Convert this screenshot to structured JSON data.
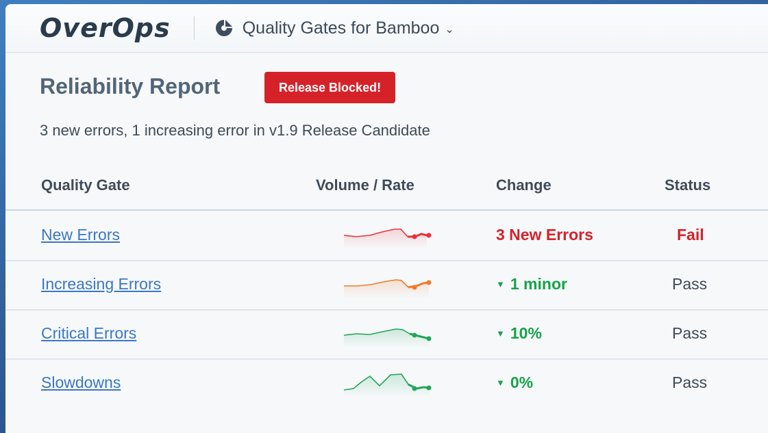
{
  "header": {
    "logo_text": "OverOps",
    "app_title": "Quality Gates for Bamboo",
    "chevron": "⌄"
  },
  "report": {
    "title": "Reliability Report",
    "badge": "Release Blocked!",
    "summary": "3 new errors, 1 increasing error in v1.9 Release Candidate"
  },
  "table": {
    "columns": [
      "Quality Gate",
      "Volume / Rate",
      "Change",
      "Status"
    ],
    "rows": [
      {
        "gate": "New Errors",
        "change": "3 New Errors",
        "status": "Fail",
        "spark_color": "#e8333a"
      },
      {
        "gate": "Increasing Errors",
        "change": "1 minor",
        "status": "Pass",
        "spark_color": "#f07a2b"
      },
      {
        "gate": "Critical Errors",
        "change": "10%",
        "status": "Pass",
        "spark_color": "#22a55a"
      },
      {
        "gate": "Slowdowns",
        "change": "0%",
        "status": "Pass",
        "spark_color": "#22a55a"
      }
    ]
  },
  "colors": {
    "fail": "#d52229",
    "pass_change": "#16a34a",
    "link": "#3a77c2"
  },
  "icons": {
    "trend_down": "▼",
    "bamboo": "bamboo-logo-icon"
  }
}
